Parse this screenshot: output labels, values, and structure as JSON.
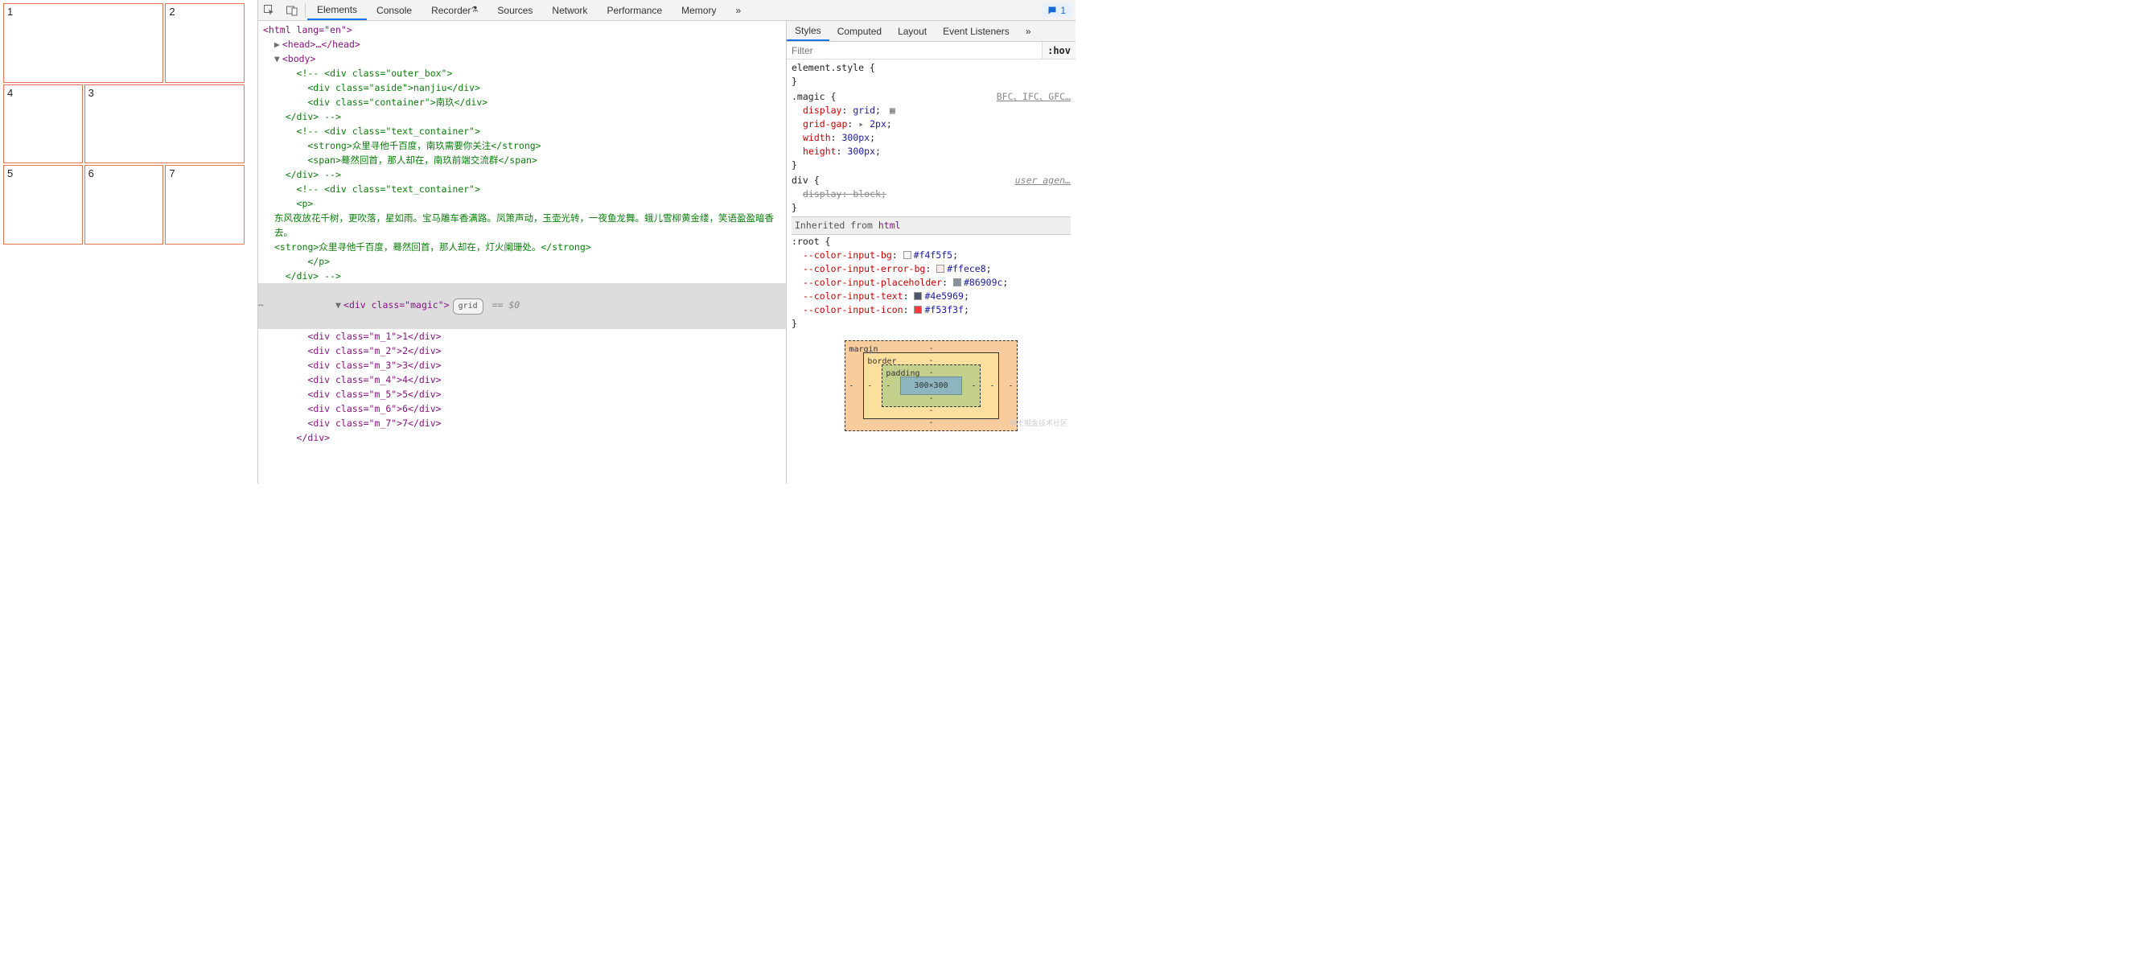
{
  "grid_cells": [
    "1",
    "2",
    "3",
    "4",
    "5",
    "6",
    "7"
  ],
  "toolbar_tabs": [
    "Elements",
    "Console",
    "Recorder",
    "Sources",
    "Network",
    "Performance",
    "Memory"
  ],
  "toolbar_active": 0,
  "toolbar_overflow": "»",
  "issues_count": "1",
  "side_tabs": [
    "Styles",
    "Computed",
    "Layout",
    "Event Listeners"
  ],
  "side_active": 0,
  "side_overflow": "»",
  "filter_placeholder": "Filter",
  "hov_label": ":hov",
  "dom": {
    "html_open": "<html lang=\"en\">",
    "head_line": "<head>…</head>",
    "body_open": "<body>",
    "c1_l1": "<!-- <div class=\"outer_box\">",
    "c1_l2": "        <div class=\"aside\">nanjiu</div>",
    "c1_l3": "        <div class=\"container\">南玖</div>",
    "c1_l4": "    </div> -->",
    "c2_l1": "<!-- <div class=\"text_container\">",
    "c2_l2": "        <strong>众里寻他千百度，南玖需要你关注</strong>",
    "c2_l3": "        <span>蓦然回首，那人却在，南玖前端交流群</span>",
    "c2_l4": "    </div> -->",
    "c3_l1": "<!-- <div class=\"text_container\">",
    "c3_l2": "      <p>",
    "c3_l3": "            东风夜放花千树，更吹落，星如雨。宝马雕车香满路。凤箫声动，玉壶光转，一夜鱼龙舞。蛾儿雪柳黄金缕，笑语盈盈暗香去。",
    "c3_l4": "            <strong>众里寻他千百度，蓦然回首，那人却在，灯火阑珊处。</strong>",
    "c3_l5": "        </p>",
    "c3_l6": "    </div> -->",
    "magic_open_a": "<div class=\"magic\">",
    "magic_badge": "grid",
    "magic_eq": " == $0",
    "m_lines": [
      "<div class=\"m_1\">1</div>",
      "<div class=\"m_2\">2</div>",
      "<div class=\"m_3\">3</div>",
      "<div class=\"m_4\">4</div>",
      "<div class=\"m_5\">5</div>",
      "<div class=\"m_6\">6</div>",
      "<div class=\"m_7\">7</div>"
    ],
    "magic_close": "</div>"
  },
  "styles": {
    "elstyle_sel": "element.style {",
    "close": "}",
    "magic_sel": ".magic {",
    "magic_src": "BFC、IFC、GFC…",
    "magic_props": [
      {
        "p": "display",
        "v": "grid",
        "grid": true
      },
      {
        "p": "grid-gap",
        "v": "2px",
        "arrow": true
      },
      {
        "p": "width",
        "v": "300px"
      },
      {
        "p": "height",
        "v": "300px"
      }
    ],
    "div_sel": "div {",
    "div_ua": "user agen…",
    "div_prop": {
      "p": "display",
      "v": "block"
    },
    "inh_label": "Inherited from ",
    "inh_sel": "html",
    "root_sel": ":root {",
    "root_props": [
      {
        "p": "--color-input-bg",
        "c": "#f4f5f5"
      },
      {
        "p": "--color-input-error-bg",
        "c": "#ffece8"
      },
      {
        "p": "--color-input-placeholder",
        "c": "#86909c"
      },
      {
        "p": "--color-input-text",
        "c": "#4e5969"
      },
      {
        "p": "--color-input-icon",
        "c": "#f53f3f"
      }
    ]
  },
  "boxmodel": {
    "margin": "margin",
    "border": "border",
    "padding": "padding",
    "dash": "-",
    "content": "300×300"
  },
  "watermark": "稀土掘金技术社区"
}
